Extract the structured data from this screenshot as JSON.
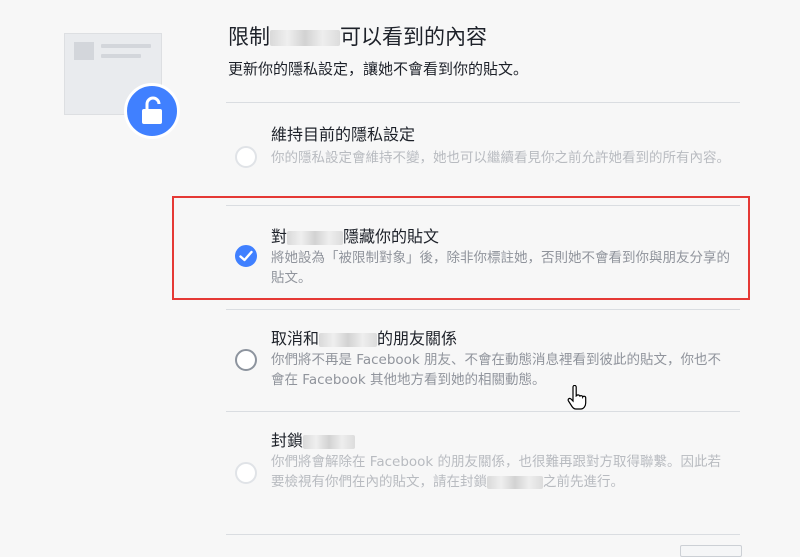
{
  "header": {
    "title_prefix": "限制",
    "title_suffix": "可以看到的內容",
    "subtitle": "更新你的隱私設定，讓她不會看到你的貼文。"
  },
  "options": [
    {
      "title": "維持目前的隱私設定",
      "description": "你的隱私設定會維持不變，她也可以繼續看見你之前允許她看到的所有內容。",
      "state": "unselected"
    },
    {
      "title_prefix": "對",
      "title_suffix": "隱藏你的貼文",
      "description": "將她設為「被限制對象」後，除非你標註她，否則她不會看到你與朋友分享的貼文。",
      "state": "selected"
    },
    {
      "title_prefix": "取消和",
      "title_suffix": "的朋友關係",
      "description": "你們將不再是 Facebook 朋友、不會在動態消息裡看到彼此的貼文，你也不會在 Facebook 其他地方看到她的相關動態。",
      "state": "unselected"
    },
    {
      "title_prefix": "封鎖",
      "description_part1": "你們將會解除在 Facebook 的朋友關係，也很難再跟對方取得聯繫。因此若要檢視有你們在內的貼文，請在封鎖",
      "description_part2": "之前先進行。",
      "state": "unselected"
    }
  ],
  "colors": {
    "accent": "#4080ff",
    "highlight_border": "#e53935"
  },
  "icons": {
    "lock": "unlocked-padlock-icon",
    "check": "checkmark-icon",
    "cursor": "hand-pointer-cursor-icon"
  }
}
